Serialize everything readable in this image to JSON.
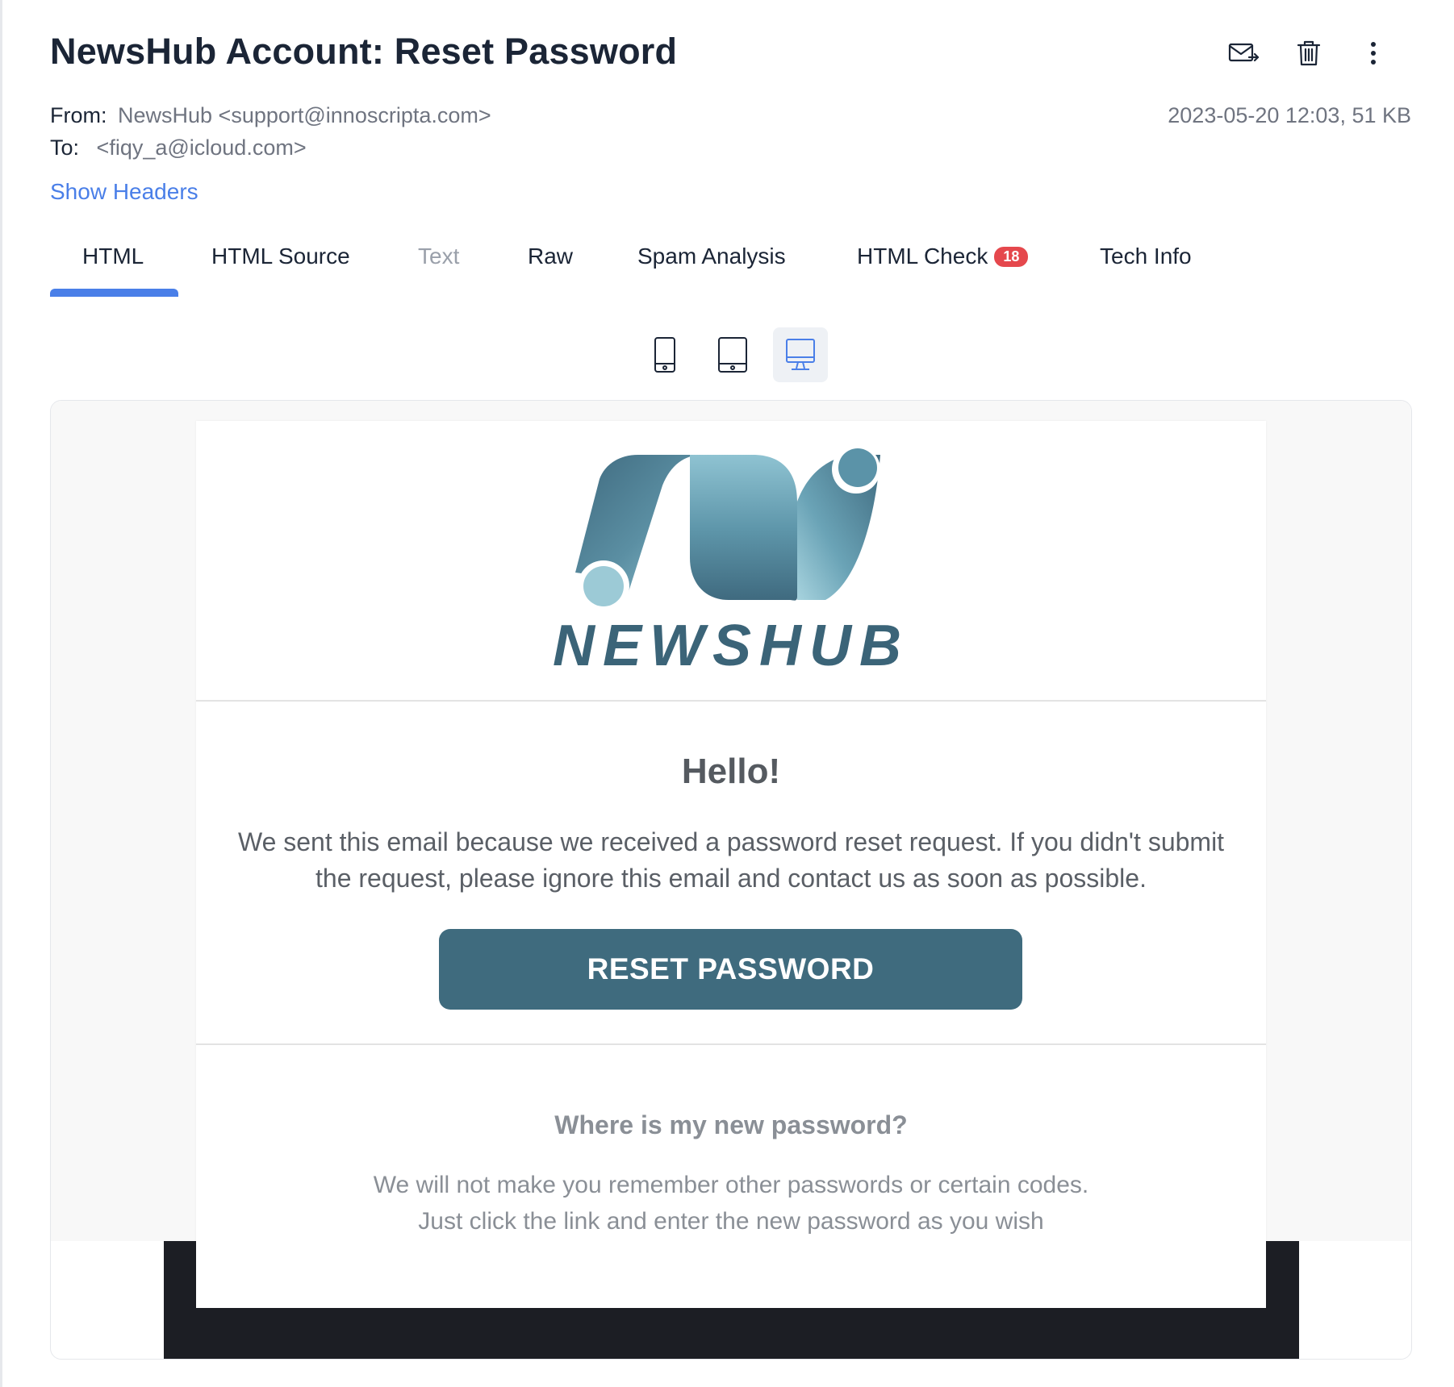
{
  "email": {
    "subject": "NewsHub Account: Reset Password",
    "from_label": "From:",
    "from_value": "NewsHub <support@innoscripta.com>",
    "to_label": "To:",
    "to_value": "<fiqy_a@icloud.com>",
    "date_size": "2023-05-20 12:03, 51 KB",
    "show_headers": "Show Headers"
  },
  "toolbar": {
    "forward_icon": "envelope-forward-icon",
    "delete_icon": "trash-icon",
    "more_icon": "vertical-ellipsis-icon"
  },
  "tabs": [
    {
      "label": "HTML",
      "active": true
    },
    {
      "label": "HTML Source"
    },
    {
      "label": "Text",
      "muted": true
    },
    {
      "label": "Raw"
    },
    {
      "label": "Spam Analysis"
    },
    {
      "label": "HTML Check",
      "badge": "18"
    },
    {
      "label": "Tech Info"
    }
  ],
  "devices": [
    {
      "icon": "mobile-icon"
    },
    {
      "icon": "tablet-icon"
    },
    {
      "icon": "desktop-icon",
      "active": true
    }
  ],
  "preview": {
    "brand": "NEWSHUB",
    "hello": "Hello!",
    "body": "We sent this email because we received a password reset request. If you didn't submit the request, please ignore this email and contact us as soon as possible.",
    "button": "RESET PASSWORD",
    "faq_title": "Where is my new password?",
    "faq_line1": "We will not make you remember other passwords or certain codes.",
    "faq_line2": "Just click the link and enter the new password as you wish"
  },
  "colors": {
    "accent": "#4a7fe8",
    "badge": "#e5484d",
    "brand_teal": "#3f6b7e",
    "dark_footer": "#1c1e24"
  }
}
